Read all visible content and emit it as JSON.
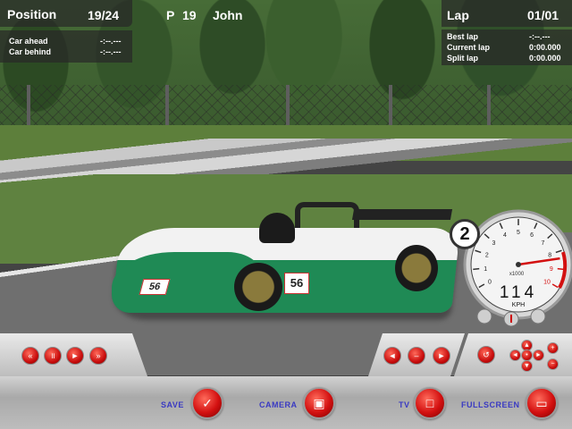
{
  "hud": {
    "position_label": "Position",
    "position_value": "19/24",
    "player_place": "P",
    "player_number": "19",
    "player_name": "John",
    "car_ahead_label": "Car ahead",
    "car_ahead_value": "-:--.---",
    "car_behind_label": "Car behind",
    "car_behind_value": "-:--.---",
    "lap_label": "Lap",
    "lap_value": "01/01",
    "best_lap_label": "Best lap",
    "best_lap_value": "-:--.---",
    "current_lap_label": "Current lap",
    "current_lap_value": "0:00.000",
    "split_lap_label": "Split lap",
    "split_lap_value": "0:00.000"
  },
  "speedometer": {
    "gear": "2",
    "speed": "114",
    "unit": "KPH",
    "rpm_multiplier": "x1000",
    "ticks": [
      "0",
      "1",
      "2",
      "3",
      "4",
      "5",
      "6",
      "7",
      "8",
      "9",
      "10"
    ],
    "rpm_level": 8.4,
    "rpm_max": 10
  },
  "car": {
    "race_number": "56"
  },
  "playback_controls": [
    {
      "name": "rewind-button",
      "glyph": "«"
    },
    {
      "name": "pause-button",
      "glyph": "॥"
    },
    {
      "name": "play-button",
      "glyph": "►"
    },
    {
      "name": "fast-forward-button",
      "glyph": "»"
    }
  ],
  "camera_nav_controls": [
    {
      "name": "camera-prev-button",
      "glyph": "◄"
    },
    {
      "name": "camera-stop-button",
      "glyph": "–"
    },
    {
      "name": "camera-next-button",
      "glyph": "►"
    }
  ],
  "toolbar": {
    "save_label": "SAVE",
    "camera_label": "CAMERA",
    "tv_label": "TV",
    "fullscreen_label": "FULLSCREEN"
  },
  "colors": {
    "accent_red": "#d31010",
    "label_blue": "#3a3ac2",
    "car_green": "#1f8a55",
    "hud_panel": "#282828"
  }
}
